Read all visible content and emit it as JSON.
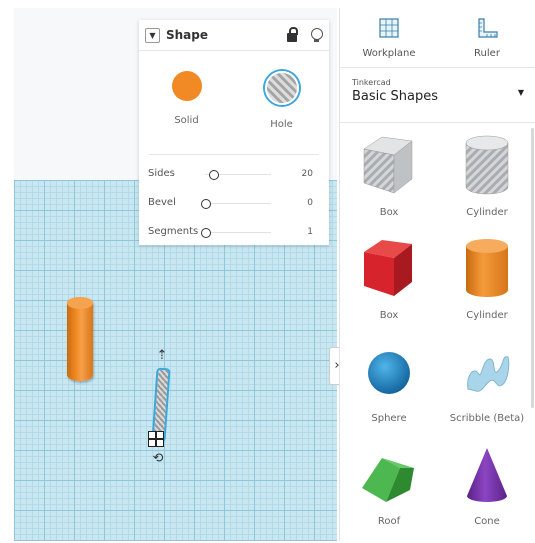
{
  "inspector": {
    "title": "Shape",
    "solid_label": "Solid",
    "hole_label": "Hole",
    "properties": [
      {
        "label": "Sides",
        "value": "20",
        "slider": 0.12
      },
      {
        "label": "Bevel",
        "value": "0",
        "slider": 0.0
      },
      {
        "label": "Segments",
        "value": "1",
        "slider": 0.0
      }
    ]
  },
  "panel": {
    "tools": [
      {
        "label": "Workplane",
        "icon": "workplane-icon"
      },
      {
        "label": "Ruler",
        "icon": "ruler-icon"
      }
    ],
    "library": {
      "vendor": "Tinkercad",
      "name": "Basic Shapes"
    },
    "shapes": [
      {
        "label": "Box"
      },
      {
        "label": "Cylinder"
      },
      {
        "label": "Box"
      },
      {
        "label": "Cylinder"
      },
      {
        "label": "Sphere"
      },
      {
        "label": "Scribble (Beta)"
      },
      {
        "label": "Roof"
      },
      {
        "label": "Cone"
      }
    ]
  },
  "colors": {
    "accent": "#3aa7dc",
    "solid_orange": "#f18a24",
    "box_red": "#d7232b",
    "sphere_blue": "#1e88c7",
    "roof_green": "#3aa53d",
    "cone_purple": "#7b3bb0",
    "grid": "#c9e7f1"
  }
}
